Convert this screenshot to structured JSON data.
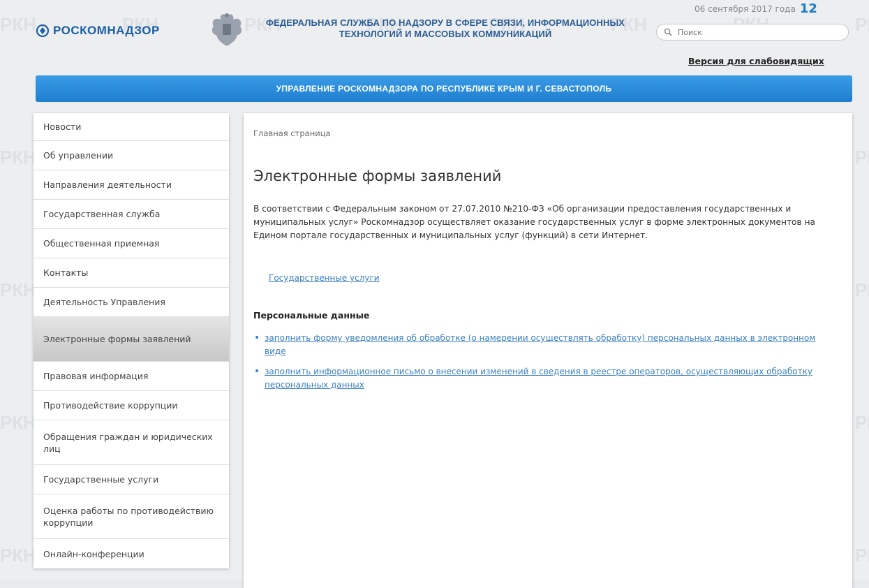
{
  "header": {
    "logo_text": "РОСКОМНАДЗОР",
    "agency_line1": "ФЕДЕРАЛЬНАЯ СЛУЖБА ПО НАДЗОРУ В СФЕРЕ СВЯЗИ, ИНФОРМАЦИОННЫХ",
    "agency_line2": "ТЕХНОЛОГИЙ И МАССОВЫХ КОММУНИКАЦИЙ",
    "date_text": "06 сентября 2017 года",
    "date_day": "12",
    "search_placeholder": "Поиск",
    "accessibility_link": "Версия для слабовидящих",
    "watermark_text": "РКН",
    "brand_color": "#1b5fa6"
  },
  "banner": {
    "text": "УПРАВЛЕНИЕ РОСКОМНАДЗОРА ПО РЕСПУБЛИКЕ КРЫМ И Г. СЕВАСТОПОЛЬ",
    "color": "#2a8ad9"
  },
  "sidebar": {
    "items": [
      {
        "label": "Новости"
      },
      {
        "label": "Об управлении"
      },
      {
        "label": "Направления деятельности"
      },
      {
        "label": "Государственная служба"
      },
      {
        "label": "Общественная приемная"
      },
      {
        "label": "Контакты"
      },
      {
        "label": "Деятельность Управления"
      },
      {
        "label": "Электронные формы заявлений",
        "active": true
      },
      {
        "label": "Правовая информация"
      },
      {
        "label": "Противодействие коррупции"
      },
      {
        "label": "Обращения граждан и юридических лиц"
      },
      {
        "label": "Государственные услуги"
      },
      {
        "label": "Оценка работы по противодействию коррупции"
      },
      {
        "label": "Онлайн-конференции"
      }
    ]
  },
  "main": {
    "breadcrumb": "Главная страница",
    "title": "Электронные формы заявлений",
    "intro": "В соответствии с Федеральным законом от 27.07.2010 №210-ФЗ «Об организации предоставления государственных и муниципальных услуг» Роскомнадзор осуществляет оказание государственных услуг в форме электронных документов на Едином портале государственных и муниципальных услуг (функций) в сети Интернет.",
    "services_link": "Государственные услуги",
    "section_title": "Персональные данные",
    "links": [
      {
        "text": "заполнить форму уведомления об обработке (о намерении осуществлять обработку) персональных данных в электронном виде"
      },
      {
        "text": "заполнить информационное письмо о внесении изменений в сведения в реестре операторов, осуществляющих обработку персональных данных"
      }
    ],
    "link_color": "#3a7fc0"
  }
}
